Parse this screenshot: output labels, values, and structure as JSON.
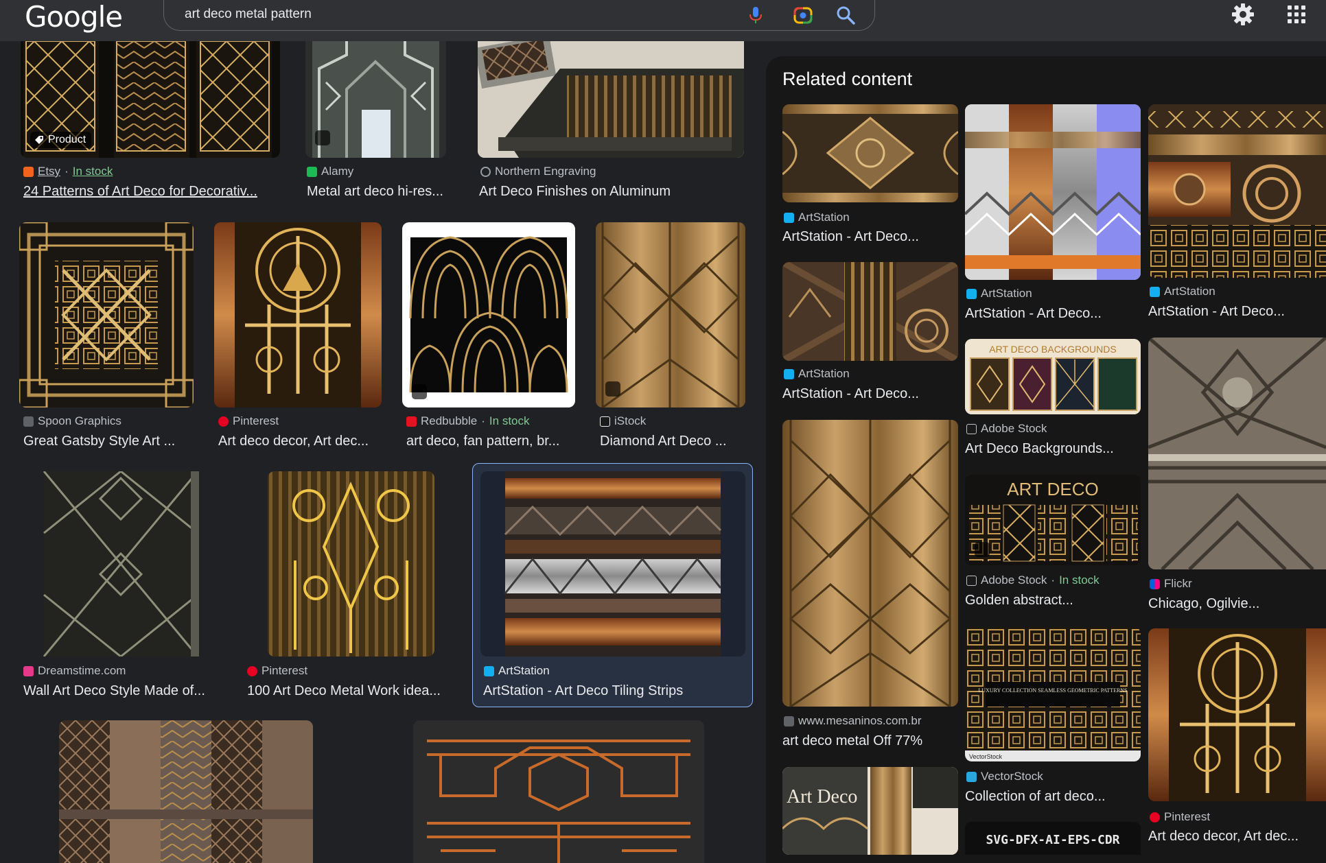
{
  "header": {
    "logo": "Google",
    "search_value": "art deco metal pattern"
  },
  "results": [
    {
      "source": "Etsy",
      "stock": "In stock",
      "title": "24 Patterns of Art Deco for Decorativ...",
      "badge": "Product"
    },
    {
      "source": "Alamy",
      "title": "Metal art deco hi-res..."
    },
    {
      "source": "Northern Engraving",
      "title": "Art Deco Finishes on Aluminum"
    },
    {
      "source": "Spoon Graphics",
      "title": "Great Gatsby Style Art ..."
    },
    {
      "source": "Pinterest",
      "title": "Art deco decor, Art dec..."
    },
    {
      "source": "Redbubble",
      "stock": "In stock",
      "title": "art deco, fan pattern, br..."
    },
    {
      "source": "iStock",
      "title": "Diamond Art Deco ..."
    },
    {
      "source": "Dreamstime.com",
      "title": "Wall Art Deco Style Made of..."
    },
    {
      "source": "Pinterest",
      "title": "100 Art Deco Metal Work idea..."
    },
    {
      "source": "ArtStation",
      "title": "ArtStation - Art Deco Tiling Strips"
    }
  ],
  "panel": {
    "title": "Related content",
    "items": [
      {
        "source": "ArtStation",
        "title": "ArtStation - Art Deco..."
      },
      {
        "source": "ArtStation",
        "title": "ArtStation - Art Deco..."
      },
      {
        "source": "www.mesaninos.com.br",
        "title": "art deco metal Off 77%"
      },
      {
        "source": "ArtStation",
        "title": "ArtStation - Art Deco..."
      },
      {
        "source": "Adobe Stock",
        "title": "Art Deco Backgrounds..."
      },
      {
        "source": "Adobe Stock",
        "stock": "In stock",
        "title": "Golden abstract..."
      },
      {
        "source": "VectorStock",
        "title": "Collection of art deco..."
      },
      {
        "source": "ArtStation",
        "title": "ArtStation - Art Deco..."
      },
      {
        "source": "Flickr",
        "title": "Chicago, Ogilvie..."
      },
      {
        "source": "Pinterest",
        "title": "Art deco decor, Art dec..."
      }
    ],
    "image_text": {
      "backgrounds": "ART DECO BACKGROUNDS",
      "art_deco": "ART DECO",
      "luxury": "LUXURY COLLECTION SEAMLESS GEOMETRIC PATTERNS",
      "vectorstock": "VectorStock",
      "art_deco_small": "Art Deco",
      "formats": "SVG-DFX-AI-EPS-CDR"
    }
  },
  "colors": {
    "background": "#202124",
    "header": "#303134",
    "panel": "#171717",
    "stock": "#81c995",
    "selected_border": "#8ab4f8"
  }
}
